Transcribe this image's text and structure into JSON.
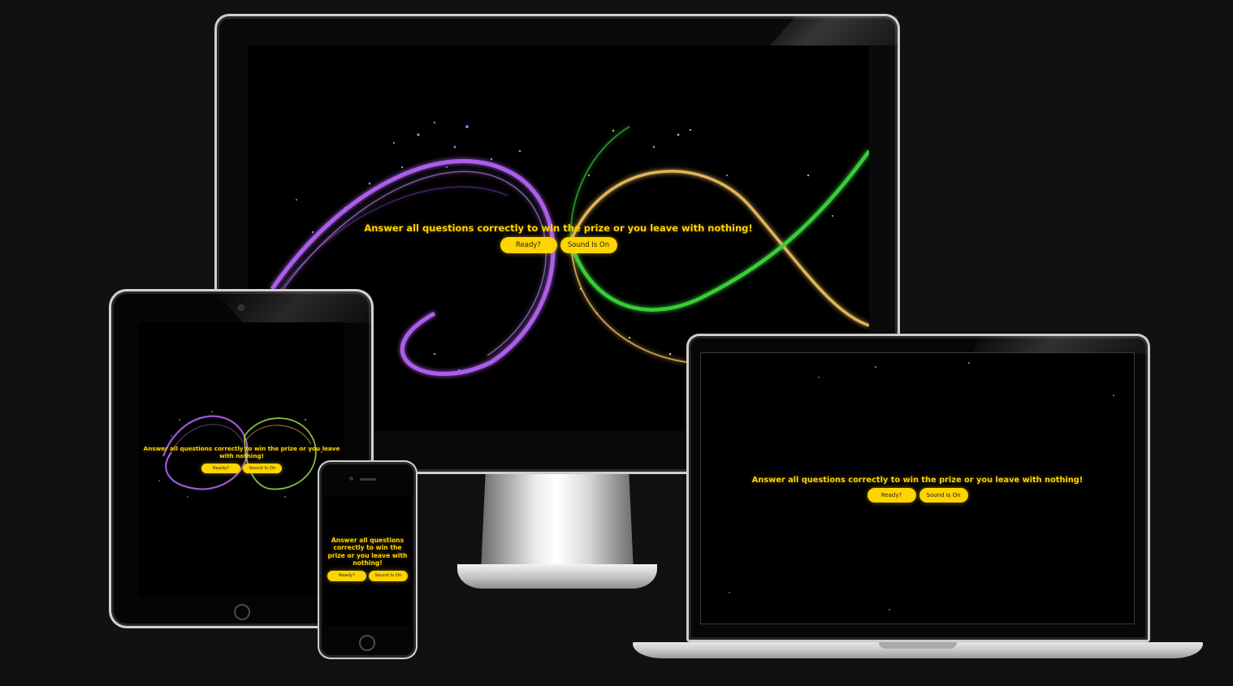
{
  "app": {
    "message": "Answer all questions correctly to win the prize or you leave with nothing!",
    "ready_label": "Ready?",
    "sound_label": "Sound Is On"
  },
  "colors": {
    "accent": "#ffd400",
    "background": "#000000",
    "page_background": "#111112",
    "ribbon_purple": "#b060f0",
    "ribbon_gold": "#f0c060",
    "ribbon_green": "#3ad23a"
  },
  "icons": [
    "home-button-icon",
    "camera-icon",
    "speaker-icon"
  ]
}
